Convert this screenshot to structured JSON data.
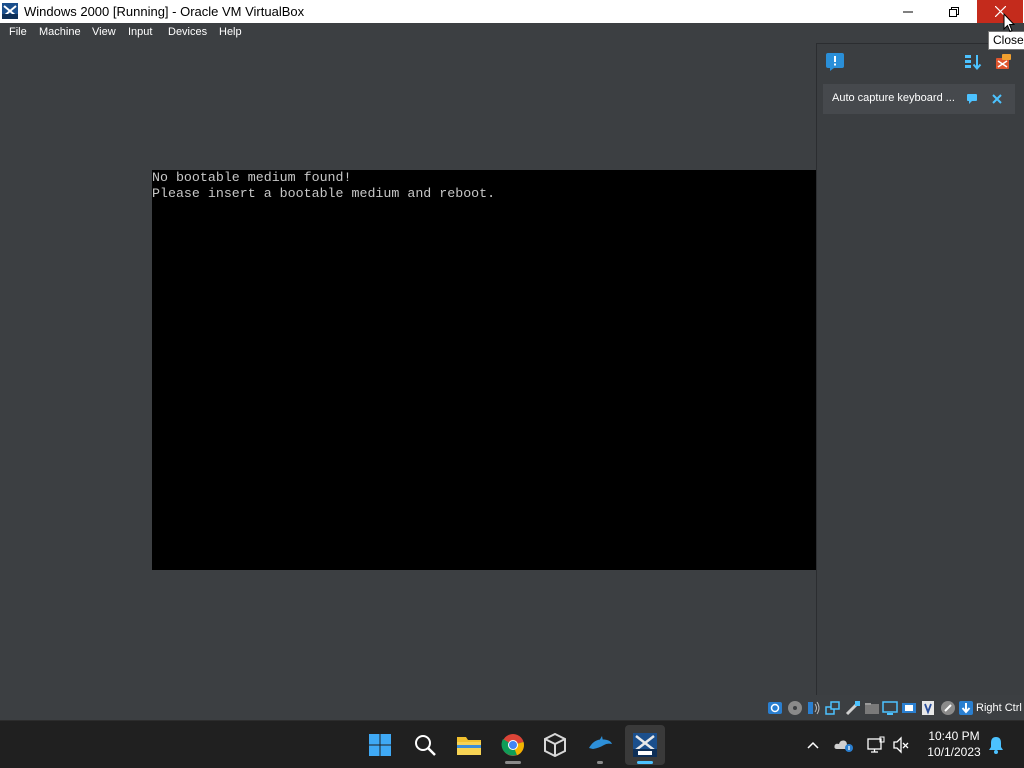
{
  "window": {
    "title": "Windows 2000 [Running] - Oracle VM VirtualBox",
    "close_tooltip": "Close"
  },
  "menu": {
    "items": [
      "File",
      "Machine",
      "View",
      "Input",
      "Devices",
      "Help"
    ]
  },
  "guest_console": {
    "lines": [
      "No bootable medium found!",
      "Please insert a bootable medium and reboot."
    ]
  },
  "notification_panel": {
    "message": "Auto capture keyboard ..."
  },
  "status_bar": {
    "host_key": "Right Ctrl",
    "icons": [
      "hard-disk-icon",
      "optical-drive-icon",
      "audio-icon",
      "network-icon",
      "usb-icon",
      "shared-folders-icon",
      "display-icon",
      "video-capture-icon",
      "vt-x-icon",
      "mouse-integration-icon",
      "keyboard-capture-icon"
    ]
  },
  "taskbar": {
    "apps": [
      "start-icon",
      "search-icon",
      "file-explorer-icon",
      "chrome-icon",
      "virtualbox-icon",
      "dolphin-icon",
      "windows-2000-vm-icon"
    ],
    "time": "10:40 PM",
    "date": "10/1/2023"
  },
  "colors": {
    "close_button": "#c42b1c",
    "vm_background": "#3c3f42",
    "taskbar": "#202020",
    "accent": "#4cc2ff"
  }
}
